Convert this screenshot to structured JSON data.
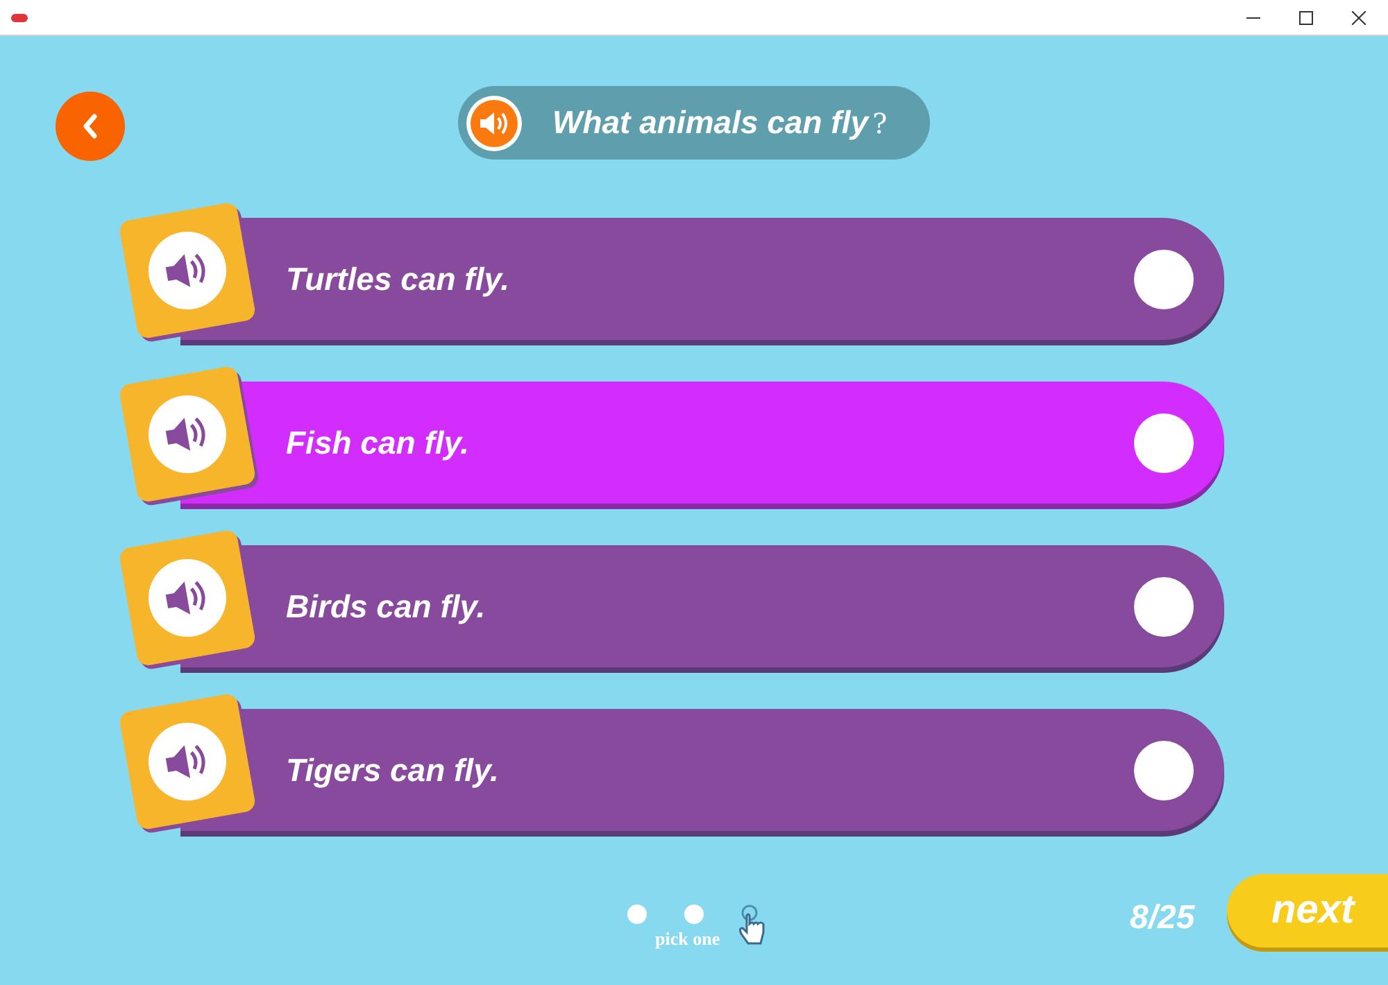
{
  "question": {
    "text": "What animals can fly",
    "mark": "?"
  },
  "options": [
    {
      "text": "Turtles can fly.",
      "selected": false
    },
    {
      "text": "Fish can fly.",
      "selected": true
    },
    {
      "text": "Birds can fly.",
      "selected": false
    },
    {
      "text": "Tigers can fly.",
      "selected": false
    }
  ],
  "hint": "pick one",
  "progress": "8/25",
  "next_button": "next"
}
